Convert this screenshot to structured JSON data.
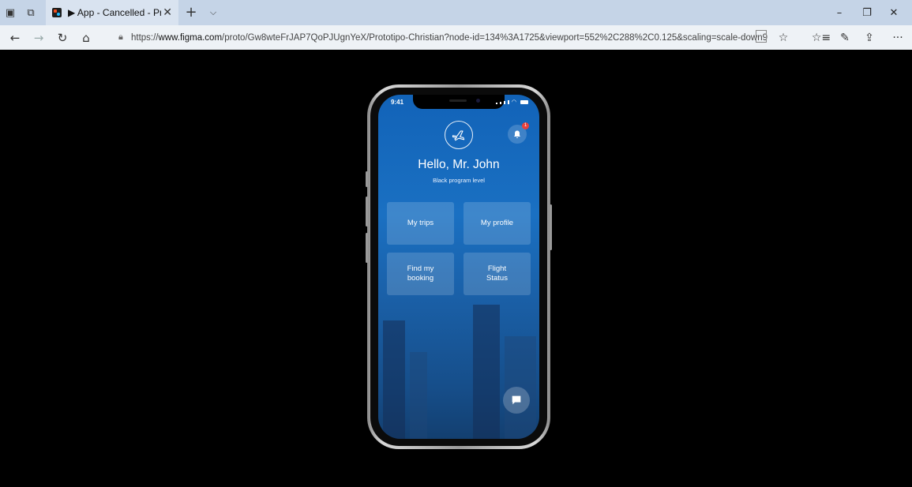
{
  "browser": {
    "tab_title": "▶ App - Cancelled - Prc",
    "tab_close": "✕",
    "new_tab": "+",
    "tab_list": "⌵",
    "window": {
      "minimize": "–",
      "restore": "❐",
      "close": "✕"
    },
    "nav": {
      "back": "←",
      "forward": "→",
      "refresh": "↻",
      "home": "⌂"
    },
    "address": {
      "lock": "🔒︎",
      "protocol": "https://",
      "domain": "www.figma.com",
      "path": "/proto/Gw8wteFrJAP7QoPJUgnYeX/Prototipo-Christian?node-id=134%3A1725&viewport=552%2C288%2C0.125&scaling=scale-down9"
    },
    "tools": {
      "favorite": "☆",
      "favorites_list": "☆≡",
      "pen": "✎",
      "share": "⇪",
      "more": "···"
    }
  },
  "phone": {
    "status": {
      "time": "9:41"
    },
    "greeting": "Hello, Mr. John",
    "program_level": "Black program level",
    "notification_count": "1",
    "tiles": [
      {
        "label": "My trips"
      },
      {
        "label": "My profile"
      },
      {
        "label": "Find my\nbooking"
      },
      {
        "label": "Flight\nStatus"
      }
    ]
  },
  "colors": {
    "screen_blue": "#1263b8",
    "badge_red": "#e8413c",
    "tab_bar": "#c5d4e7"
  }
}
